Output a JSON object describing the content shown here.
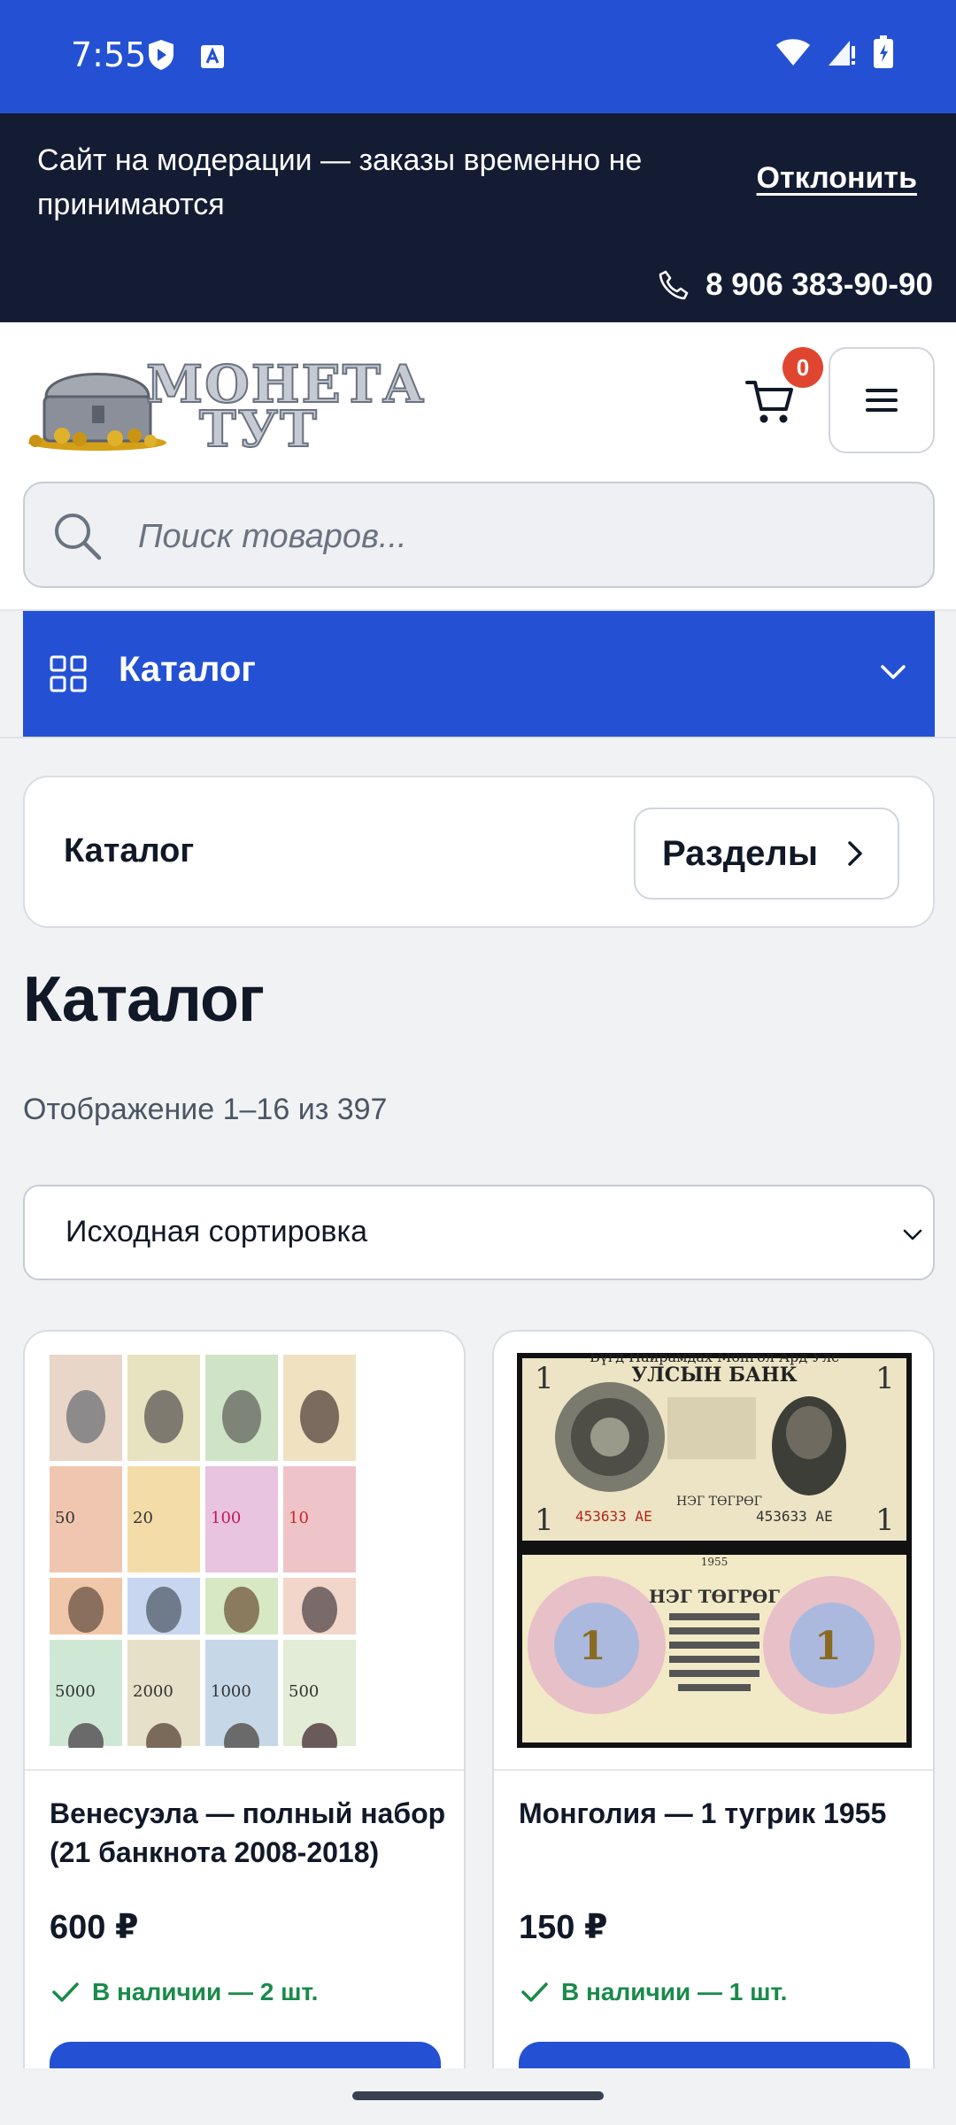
{
  "status": {
    "time": "7:55"
  },
  "banner": {
    "message": "Сайт на модерации — заказы временно не принимаются",
    "dismiss_label": "Отклонить",
    "phone": "8 906 383-90-90"
  },
  "header": {
    "logo_line1": "МОНЕТА",
    "logo_line2": "ТУТ",
    "cart_count": "0",
    "search_placeholder": "Поиск товаров..."
  },
  "catalog_bar": {
    "label": "Каталог"
  },
  "breadcrumb": {
    "current": "Каталог",
    "sections_label": "Разделы"
  },
  "page": {
    "title": "Каталог",
    "results_text": "Отображение 1–16 из 397",
    "sort_selected": "Исходная сортировка"
  },
  "products": [
    {
      "name": "Венесуэла — полный набор (21 банкнота 2008-2018)",
      "price": "600 ₽",
      "stock": "В наличии — 2 шт."
    },
    {
      "name": "Монголия — 1 тугрик 1955",
      "price": "150 ₽",
      "stock": "В наличии — 1 шт."
    }
  ],
  "banknote_texts": {
    "mongolia_top": "Бүгд Найрамдах Монгол Ард Улс",
    "mongolia_bank": "УЛСЫН БАНК",
    "mongolia_serial": "453633 АЕ",
    "mongolia_denom": "НЭГ ТӨГРӨГ",
    "mongolia_year": "1955",
    "venezuela_values": [
      "50",
      "20",
      "100",
      "10",
      "5000",
      "2000",
      "1000",
      "500"
    ]
  },
  "colors": {
    "brand_blue": "#2451d4",
    "banner_bg": "#141c33",
    "badge_red": "#e0462f",
    "stock_green": "#1a8a4a"
  },
  "icons": [
    "shield-icon",
    "keyboard-icon",
    "wifi-icon",
    "signal-icon",
    "battery-icon",
    "phone-icon",
    "cart-icon",
    "menu-icon",
    "search-icon",
    "grid-icon",
    "chevron-down-icon",
    "chevron-right-icon",
    "check-icon"
  ]
}
